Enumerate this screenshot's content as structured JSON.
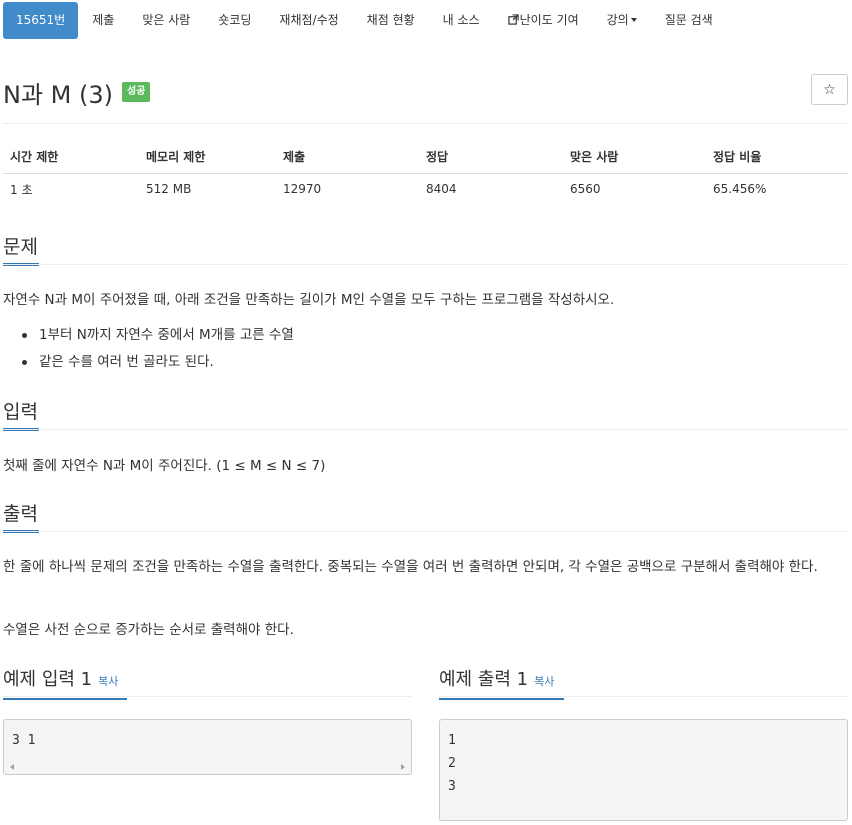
{
  "nav": {
    "items": [
      {
        "label": "15651번",
        "active": true
      },
      {
        "label": "제출"
      },
      {
        "label": "맞은 사람"
      },
      {
        "label": "숏코딩"
      },
      {
        "label": "재채점/수정"
      },
      {
        "label": "채점 현황"
      },
      {
        "label": "내 소스"
      },
      {
        "label": "난이도 기여",
        "icon": "external-link-icon"
      },
      {
        "label": "강의",
        "icon": "caret-down-icon"
      },
      {
        "label": "질문 검색"
      }
    ]
  },
  "problem": {
    "title": "N과 M (3)",
    "status_badge": "성공",
    "star_icon": "☆"
  },
  "info_table": {
    "headers": [
      "시간 제한",
      "메모리 제한",
      "제출",
      "정답",
      "맞은 사람",
      "정답 비율"
    ],
    "row": [
      "1 초",
      "512 MB",
      "12970",
      "8404",
      "6560",
      "65.456%"
    ]
  },
  "sections": {
    "description": {
      "heading": "문제",
      "text": "자연수 N과 M이 주어졌을 때, 아래 조건을 만족하는 길이가 M인 수열을 모두 구하는 프로그램을 작성하시오.",
      "bullets": [
        "1부터 N까지 자연수 중에서 M개를 고른 수열",
        "같은 수를 여러 번 골라도 된다."
      ]
    },
    "input": {
      "heading": "입력",
      "text": "첫째 줄에 자연수 N과 M이 주어진다. (1 ≤ M ≤ N ≤ 7)"
    },
    "output": {
      "heading": "출력",
      "text1": "한 줄에 하나씩 문제의 조건을 만족하는 수열을 출력한다. 중복되는 수열을 여러 번 출력하면 안되며, 각 수열은 공백으로 구분해서 출력해야 한다.",
      "text2": "수열은 사전 순으로 증가하는 순서로 출력해야 한다."
    }
  },
  "samples": {
    "input": {
      "heading": "예제 입력 1",
      "copy_label": "복사",
      "lines": [
        "3 1"
      ]
    },
    "output": {
      "heading": "예제 출력 1",
      "copy_label": "복사",
      "lines": [
        "1",
        "2",
        "3"
      ]
    }
  },
  "colors": {
    "accent": "#337ab7",
    "nav_active": "#428bca",
    "success": "#5cb85c"
  }
}
